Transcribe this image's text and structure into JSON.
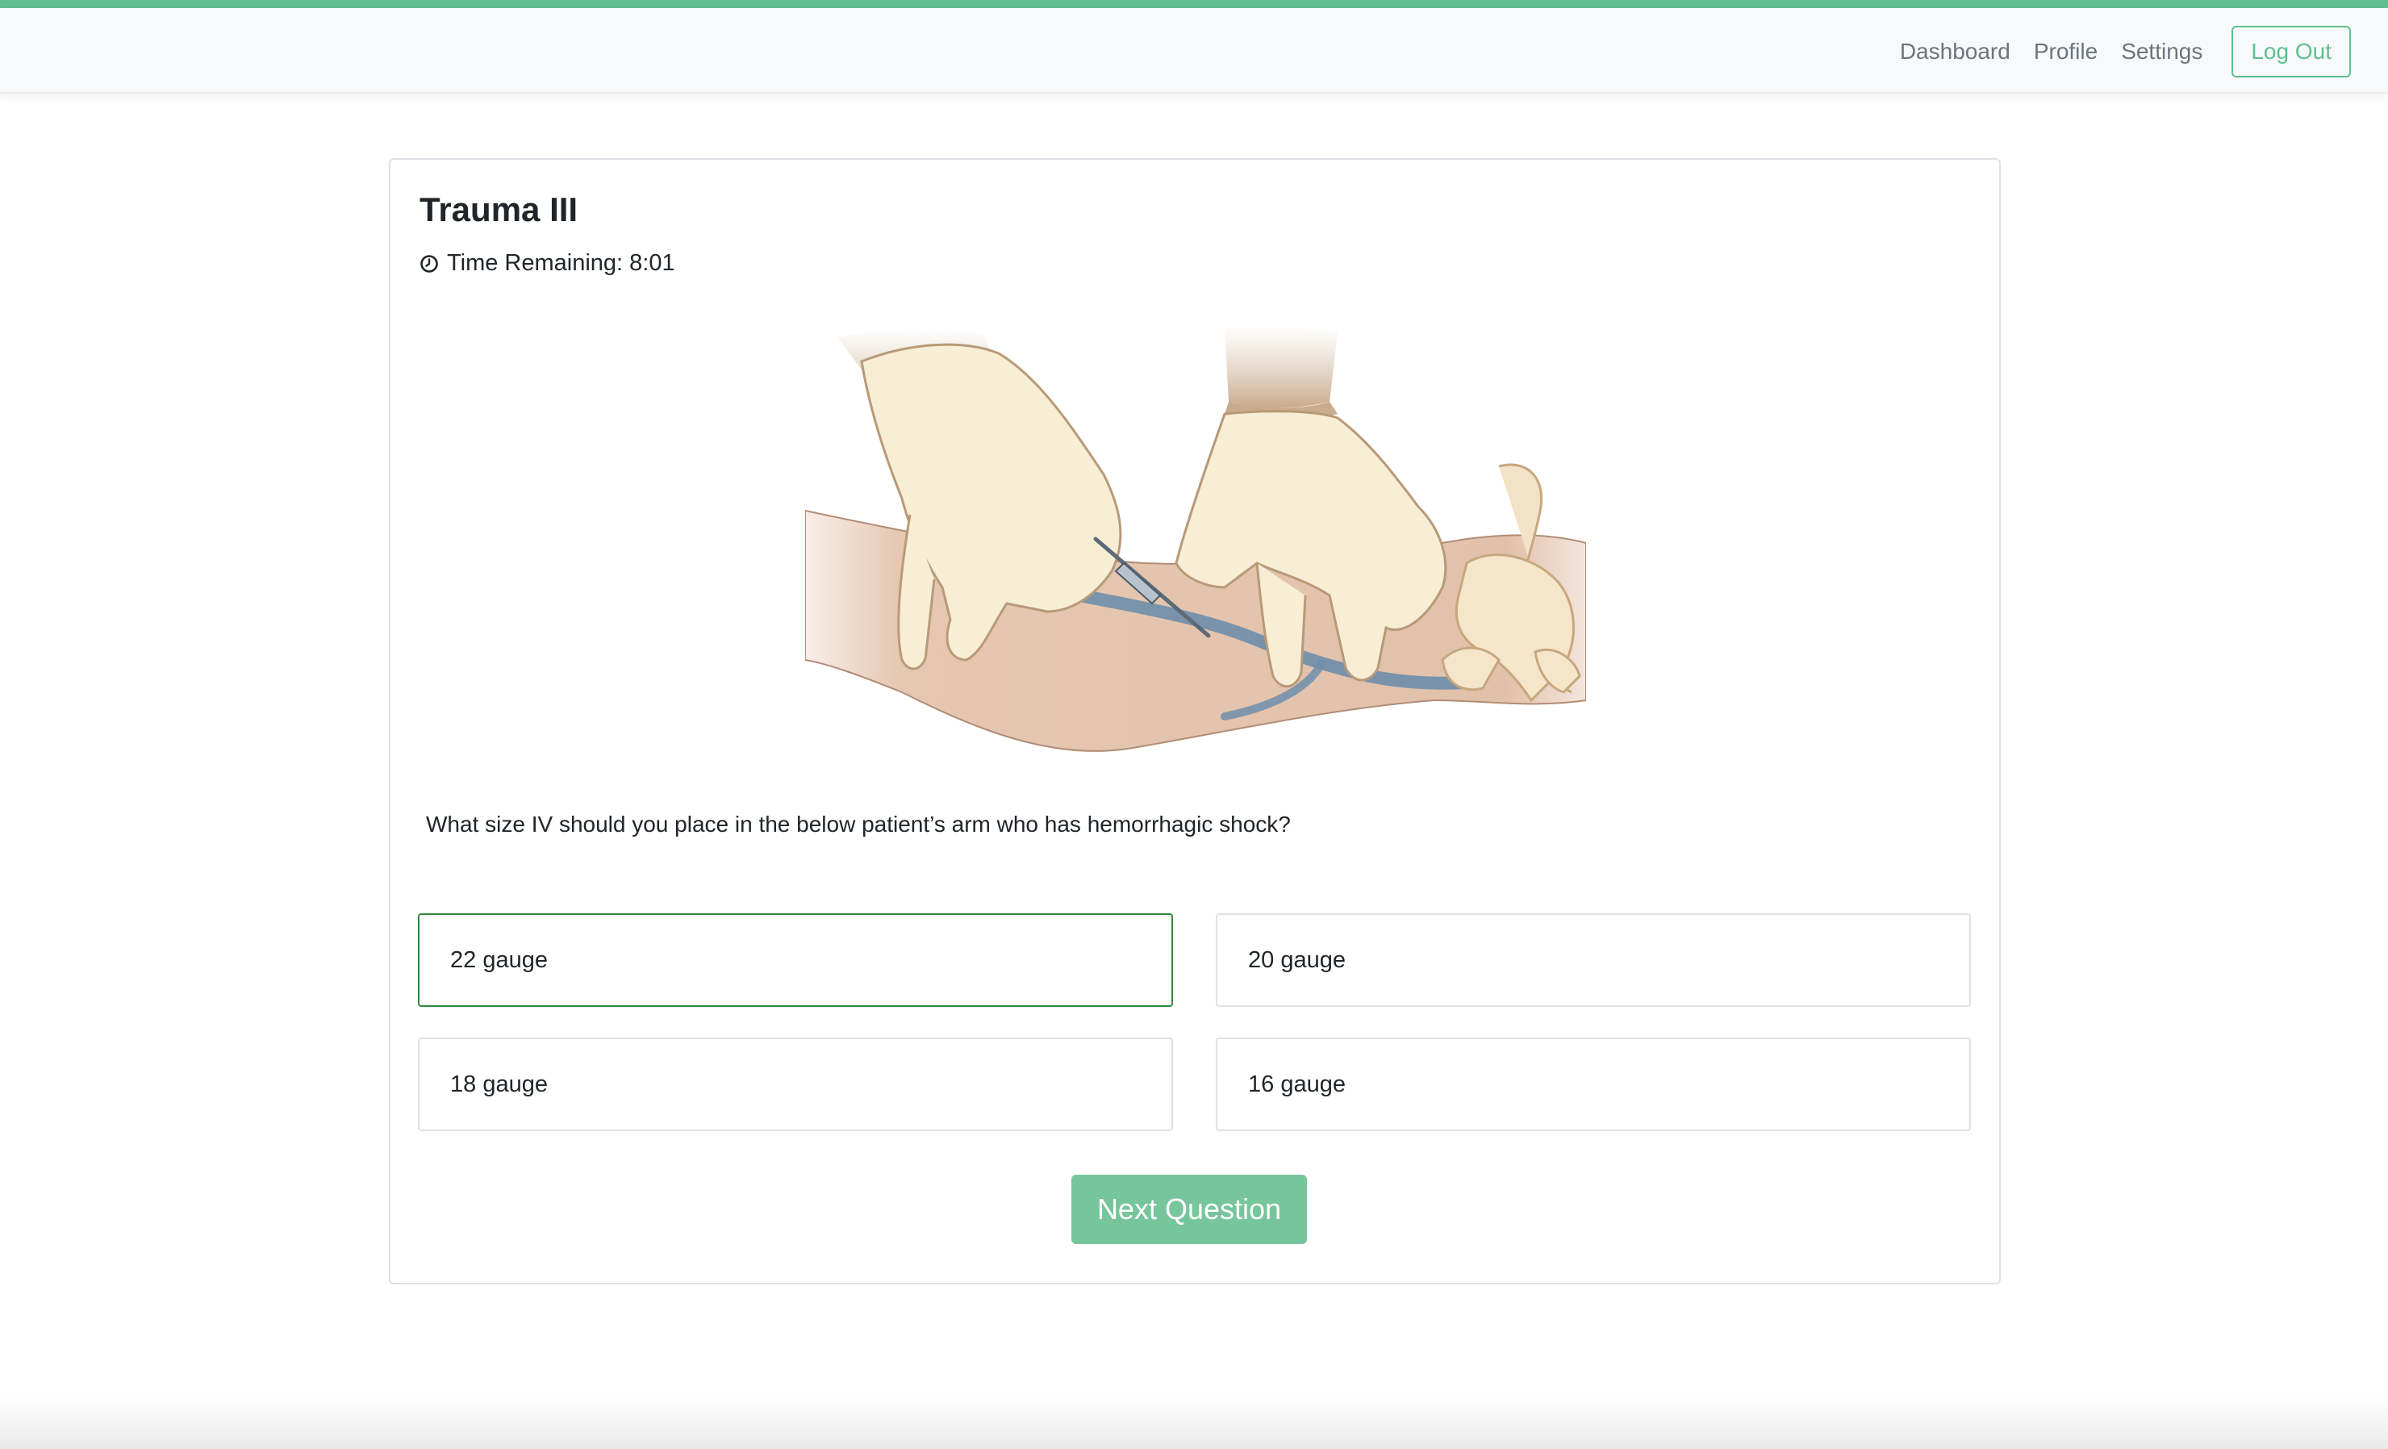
{
  "nav": {
    "links": [
      "Dashboard",
      "Profile",
      "Settings"
    ],
    "logout_label": "Log Out"
  },
  "quiz": {
    "title": "Trauma III",
    "timer_label": "Time Remaining: 8:01",
    "question": "What size IV should you place in the below patient’s arm who has hemorrhagic shock?",
    "options": [
      "22 gauge",
      "20 gauge",
      "18 gauge",
      "16 gauge"
    ],
    "selected_option": "22 gauge",
    "next_label": "Next Question"
  },
  "icons": {
    "timer": "clock-icon"
  },
  "colors": {
    "accent": "#5fbf8f",
    "primary_button": "#77c59b",
    "selected_border": "#2f8a3a"
  }
}
